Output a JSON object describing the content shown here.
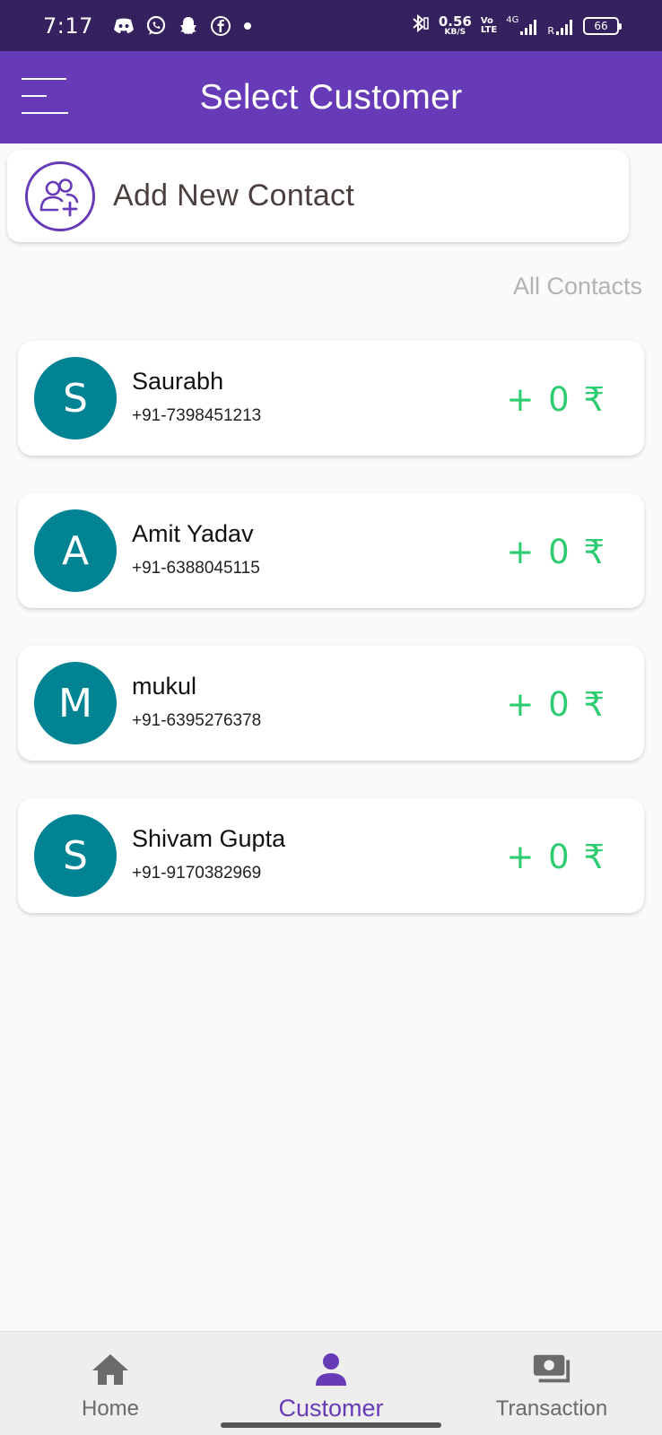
{
  "status_bar": {
    "time": "7:17",
    "net_speed_value": "0.56",
    "net_speed_unit": "KB/S",
    "volte_top": "Vo",
    "volte_bottom": "LTE",
    "network_type": "4G",
    "roaming": "R",
    "battery": "66",
    "icons": [
      "discord-icon",
      "whatsapp-icon",
      "snapchat-icon",
      "facebook-icon",
      "notification-dot",
      "bluetooth-icon",
      "signal-icon"
    ]
  },
  "app_bar": {
    "title": "Select Customer",
    "menu_icon": "menu-icon"
  },
  "add_contact": {
    "label": "Add New Contact",
    "icon": "add-user-icon",
    "accent": "#673ab7"
  },
  "section": {
    "label": "All Contacts"
  },
  "contacts": [
    {
      "initial": "S",
      "name": "Saurabh",
      "phone": "+91-7398451213",
      "amount": "+ 0 ₹"
    },
    {
      "initial": "A",
      "name": "Amit Yadav",
      "phone": "+91-6388045115",
      "amount": "+ 0 ₹"
    },
    {
      "initial": "M",
      "name": "mukul",
      "phone": "+91-6395276378",
      "amount": "+ 0 ₹"
    },
    {
      "initial": "S",
      "name": "Shivam Gupta",
      "phone": "+91-9170382969",
      "amount": "+ 0 ₹"
    }
  ],
  "bottom_nav": {
    "items": [
      {
        "label": "Home",
        "icon": "home-icon",
        "active": false
      },
      {
        "label": "Customer",
        "icon": "person-icon",
        "active": true
      },
      {
        "label": "Transaction",
        "icon": "cash-icon",
        "active": false
      }
    ]
  },
  "colors": {
    "status_bar": "#34215e",
    "primary": "#673ab7",
    "avatar": "#008393",
    "amount": "#2ecc71"
  }
}
